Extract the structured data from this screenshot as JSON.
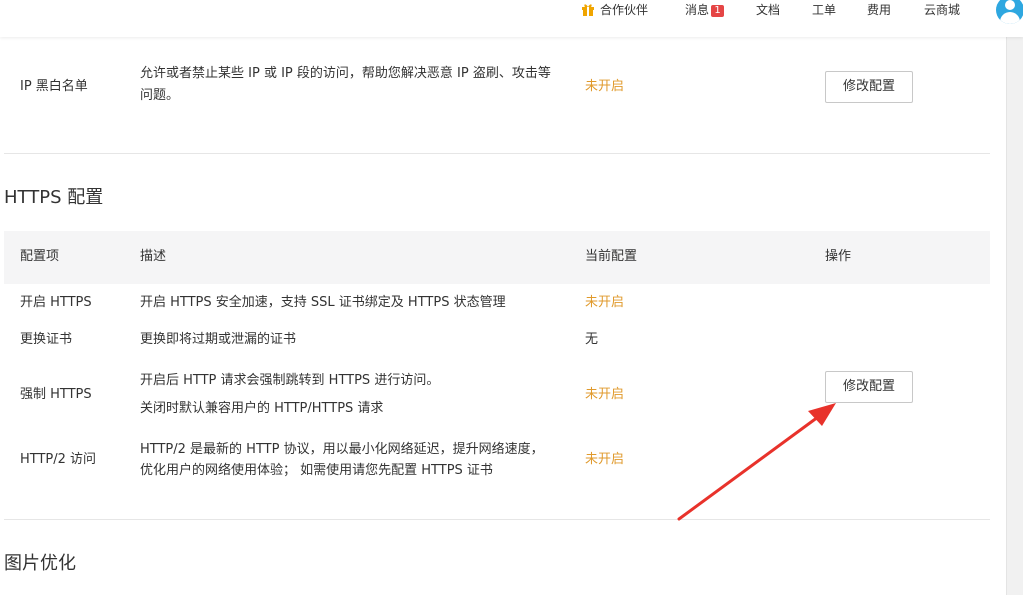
{
  "topbar": {
    "partner": "合作伙伴",
    "messages": "消息",
    "messages_count": "1",
    "docs": "文档",
    "tickets": "工单",
    "billing": "费用",
    "marketplace": "云商城"
  },
  "ip_blacklist": {
    "name": "IP 黑白名单",
    "desc": "允许或者禁止某些 IP 或 IP 段的访问，帮助您解决恶意 IP 盗刷、攻击等问题。",
    "status": "未开启",
    "button": "修改配置"
  },
  "https_section": {
    "title": "HTTPS 配置",
    "headers": {
      "item": "配置项",
      "desc": "描述",
      "current": "当前配置",
      "action": "操作"
    },
    "rows": [
      {
        "name": "开启 HTTPS",
        "desc": "开启 HTTPS 安全加速，支持 SSL 证书绑定及 HTTPS 状态管理",
        "status": "未开启"
      },
      {
        "name": "更换证书",
        "desc": "更换即将过期或泄漏的证书",
        "status": "无"
      },
      {
        "name": "强制 HTTPS",
        "desc_line1": "开启后 HTTP 请求会强制跳转到 HTTPS 进行访问。",
        "desc_line2": "关闭时默认兼容用户的 HTTP/HTTPS 请求",
        "status": "未开启"
      },
      {
        "name": "HTTP/2 访问",
        "desc": "HTTP/2 是最新的 HTTP 协议，用以最小化网络延迟，提升网络速度，优化用户的网络使用体验； 如需使用请您先配置 HTTPS 证书",
        "status": "未开启"
      }
    ],
    "button": "修改配置"
  },
  "image_section": {
    "title": "图片优化"
  },
  "colors": {
    "status_off": "#e09a2c",
    "annotation_arrow": "#e8322b",
    "partner_accent": "#e89a0c",
    "badge": "#e54545"
  }
}
